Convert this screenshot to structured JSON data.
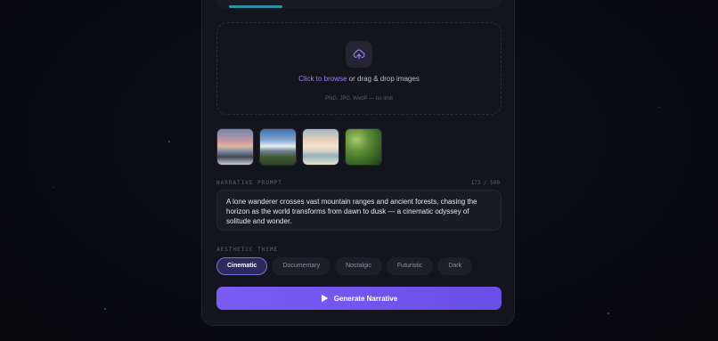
{
  "upload": {
    "link_text": "Click to browse",
    "rest_text": " or drag & drop images",
    "hint": "PNG, JPG, WebP — no limit",
    "icon": "upload-cloud-icon"
  },
  "images": [
    {
      "alt": "mountain lake at sunset"
    },
    {
      "alt": "snowy mountains and forest"
    },
    {
      "alt": "beach at sunrise"
    },
    {
      "alt": "green tea hills"
    }
  ],
  "prompt": {
    "label": "NARRATIVE PROMPT",
    "counter": "173 / 500",
    "value": "A lone wanderer crosses vast mountain ranges and ancient forests, chasing the horizon as the world transforms from dawn to dusk — a cinematic odyssey of solitude and wonder."
  },
  "theme": {
    "label": "AESTHETIC THEME",
    "options": [
      "Cinematic",
      "Documentary",
      "Nostalgic",
      "Futuristic",
      "Dark"
    ],
    "selected": "Cinematic"
  },
  "generate": {
    "label": "Generate Narrative",
    "icon": "play-icon"
  },
  "colors": {
    "accent": "#7a5cf4",
    "link": "#9b7cf6",
    "active_chip_border": "#6f73d8"
  }
}
